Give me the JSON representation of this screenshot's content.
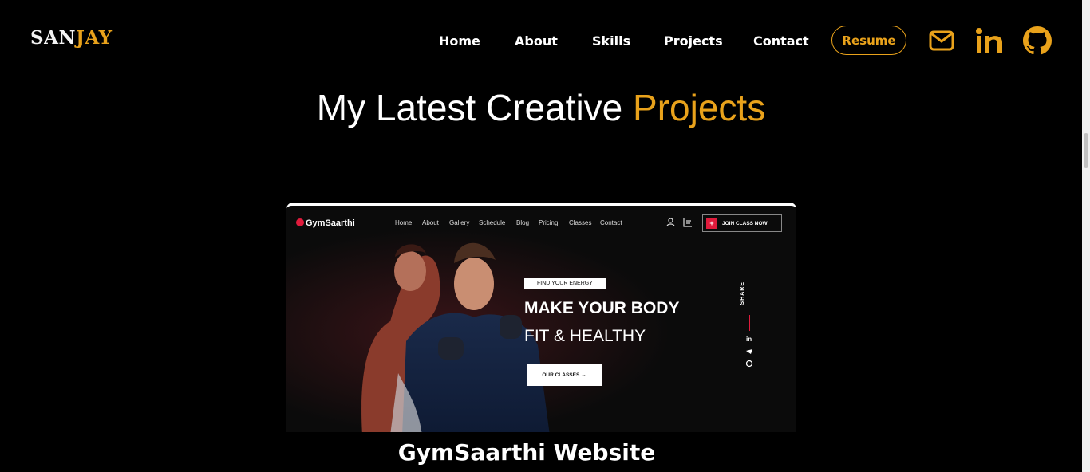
{
  "brand": {
    "part1": "SAN",
    "part2": "JAY"
  },
  "nav": {
    "home": "Home",
    "about": "About",
    "skills": "Skills",
    "projects": "Projects",
    "contact": "Contact",
    "resume": "Resume"
  },
  "social_icons": [
    "mail-icon",
    "linkedin-icon",
    "github-icon"
  ],
  "section": {
    "title_part1": "My Latest Creative ",
    "title_part2": "Projects"
  },
  "project": {
    "title": "GymSaarthi Website",
    "preview": {
      "logo": "GymSaarthi",
      "nav": [
        "Home",
        "About",
        "Gallery",
        "Schedule",
        "Blog",
        "Pricing",
        "Classes",
        "Contact"
      ],
      "join_button": "JOIN CLASS NOW",
      "tagline": "FIND YOUR ENERGY",
      "headline1": "MAKE YOUR BODY",
      "headline2": "FIT & HEALTHY",
      "cta": "OUR CLASSES →",
      "share": "SHARE"
    }
  },
  "colors": {
    "accent": "#e9a21b",
    "background": "#000000",
    "gym_red": "#e01b3c"
  }
}
